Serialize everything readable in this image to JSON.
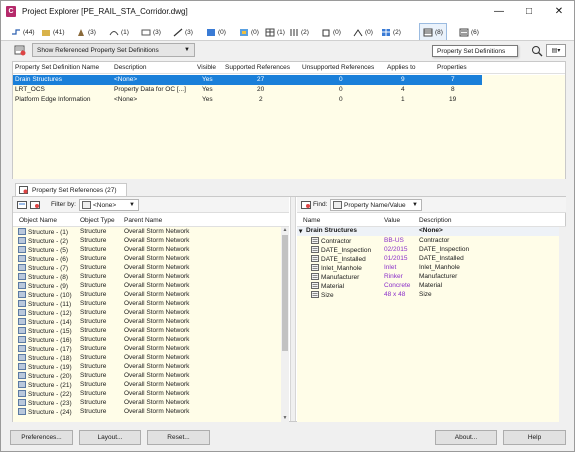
{
  "window": {
    "title": "Project Explorer [PE_RAIL_STA_Corridor.dwg]",
    "app_icon_letter": "C"
  },
  "tabs": [
    {
      "icon": "arrow-icon",
      "count": "(44)"
    },
    {
      "icon": "folder-icon",
      "count": "(41)"
    },
    {
      "icon": "pipe-icon",
      "count": "(3)"
    },
    {
      "icon": "alignment-icon",
      "count": "(1)"
    },
    {
      "icon": "corridor-icon",
      "count": "(3)"
    },
    {
      "icon": "line-icon",
      "count": "(3)"
    },
    {
      "icon": "blue-box-icon",
      "count": "(0)"
    },
    {
      "icon": "chart-icon",
      "count": "(0)"
    },
    {
      "icon": "table-icon",
      "count": "(1)"
    },
    {
      "icon": "grid-icon",
      "count": "(2)"
    },
    {
      "icon": "structure-icon",
      "count": "(0)"
    },
    {
      "icon": "network-icon",
      "count": "(0)"
    },
    {
      "icon": "blue-grid-icon",
      "count": "(2)"
    },
    {
      "icon": "property-set-icon",
      "count": "(8)"
    },
    {
      "icon": "list-icon",
      "count": "(6)"
    }
  ],
  "tooltip": "Property Set Definitions",
  "options": {
    "show_dropdown": "Show Referenced Property Set Definitions"
  },
  "top_table": {
    "columns": [
      "Property Set Definition Name",
      "Description",
      "Visible",
      "Supported References",
      "Unsupported References",
      "Applies to",
      "Properties"
    ],
    "rows": [
      {
        "name": "Drain Structures",
        "description": "<None>",
        "visible": "Yes",
        "supported": "27",
        "unsupported": "0",
        "applies": "9",
        "properties": "7"
      },
      {
        "name": "LRT_OCS",
        "description": "Property Data for OC [...]",
        "visible": "Yes",
        "supported": "20",
        "unsupported": "0",
        "applies": "4",
        "properties": "8"
      },
      {
        "name": "Platform Edge Information",
        "description": "<None>",
        "visible": "Yes",
        "supported": "2",
        "unsupported": "0",
        "applies": "1",
        "properties": "19"
      }
    ]
  },
  "ref_tab": {
    "label": "Property Set References (27)"
  },
  "left_panel": {
    "filter_label": "Filter by:",
    "filter_value": "<None>",
    "columns": [
      "Object Name",
      "Object Type",
      "Parent Name"
    ],
    "rows": [
      {
        "name": "Structure - (1)",
        "type": "Structure",
        "parent": "Overall Storm Network"
      },
      {
        "name": "Structure - (2)",
        "type": "Structure",
        "parent": "Overall Storm Network"
      },
      {
        "name": "Structure - (5)",
        "type": "Structure",
        "parent": "Overall Storm Network"
      },
      {
        "name": "Structure - (6)",
        "type": "Structure",
        "parent": "Overall Storm Network"
      },
      {
        "name": "Structure - (7)",
        "type": "Structure",
        "parent": "Overall Storm Network"
      },
      {
        "name": "Structure - (8)",
        "type": "Structure",
        "parent": "Overall Storm Network"
      },
      {
        "name": "Structure - (9)",
        "type": "Structure",
        "parent": "Overall Storm Network"
      },
      {
        "name": "Structure - (10)",
        "type": "Structure",
        "parent": "Overall Storm Network"
      },
      {
        "name": "Structure - (11)",
        "type": "Structure",
        "parent": "Overall Storm Network"
      },
      {
        "name": "Structure - (12)",
        "type": "Structure",
        "parent": "Overall Storm Network"
      },
      {
        "name": "Structure - (14)",
        "type": "Structure",
        "parent": "Overall Storm Network"
      },
      {
        "name": "Structure - (15)",
        "type": "Structure",
        "parent": "Overall Storm Network"
      },
      {
        "name": "Structure - (16)",
        "type": "Structure",
        "parent": "Overall Storm Network"
      },
      {
        "name": "Structure - (17)",
        "type": "Structure",
        "parent": "Overall Storm Network"
      },
      {
        "name": "Structure - (18)",
        "type": "Structure",
        "parent": "Overall Storm Network"
      },
      {
        "name": "Structure - (19)",
        "type": "Structure",
        "parent": "Overall Storm Network"
      },
      {
        "name": "Structure - (20)",
        "type": "Structure",
        "parent": "Overall Storm Network"
      },
      {
        "name": "Structure - (21)",
        "type": "Structure",
        "parent": "Overall Storm Network"
      },
      {
        "name": "Structure - (22)",
        "type": "Structure",
        "parent": "Overall Storm Network"
      },
      {
        "name": "Structure - (23)",
        "type": "Structure",
        "parent": "Overall Storm Network"
      },
      {
        "name": "Structure - (24)",
        "type": "Structure",
        "parent": "Overall Storm Network"
      }
    ]
  },
  "right_panel": {
    "find_label": "Find:",
    "find_value": "Property Name/Value",
    "columns": [
      "Name",
      "Value",
      "Description"
    ],
    "group": {
      "name": "Drain Structures",
      "description": "<None>"
    },
    "rows": [
      {
        "name": "Contractor",
        "value": "BB-US",
        "description": "Contractor"
      },
      {
        "name": "DATE_Inspection",
        "value": "02/2015",
        "description": "DATE_Inspection"
      },
      {
        "name": "DATE_Installed",
        "value": "01/2015",
        "description": "DATE_Installed"
      },
      {
        "name": "Inlet_Manhole",
        "value": "Inlet",
        "description": "Inlet_Manhole"
      },
      {
        "name": "Manufacturer",
        "value": "Rinker",
        "description": "Manufacturer"
      },
      {
        "name": "Material",
        "value": "Concrete",
        "description": "Material"
      },
      {
        "name": "Size",
        "value": "48 x 48",
        "description": "Size"
      }
    ]
  },
  "buttons": {
    "preferences": "Preferences...",
    "layout": "Layout...",
    "reset": "Reset...",
    "about": "About...",
    "help": "Help"
  },
  "colors": {
    "selection": "#1a7fd9",
    "row_bg": "#fffde8",
    "value_purple": "#8b2fc9"
  }
}
